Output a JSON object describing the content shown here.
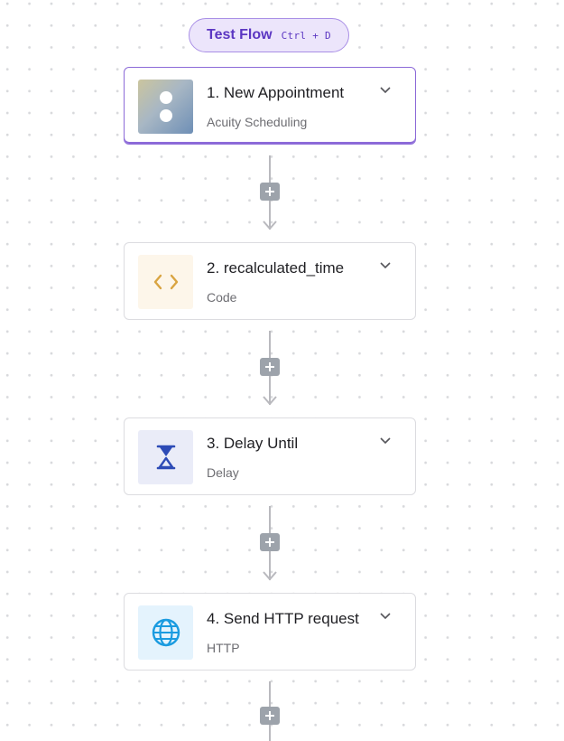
{
  "toolbar": {
    "test_flow_label": "Test Flow",
    "test_flow_shortcut": "Ctrl + D"
  },
  "steps": [
    {
      "title": "1. New Appointment",
      "subtitle": "Acuity Scheduling",
      "icon": "acuity-scheduling-logo",
      "selected": true
    },
    {
      "title": "2. recalculated_time",
      "subtitle": "Code",
      "icon": "code-brackets-icon",
      "selected": false
    },
    {
      "title": "3. Delay Until",
      "subtitle": "Delay",
      "icon": "hourglass-icon",
      "selected": false
    },
    {
      "title": "4. Send HTTP request",
      "subtitle": "HTTP",
      "icon": "globe-icon",
      "selected": false
    }
  ],
  "colors": {
    "accent": "#8c6ad8",
    "test_flow_bg": "#ece5fb",
    "test_flow_text": "#5b36c2",
    "connector": "#b9b9be",
    "add_button": "#9da3ab",
    "code_icon": "#d9a441",
    "delay_icon": "#2d4bb6",
    "http_icon": "#1a9be0"
  }
}
